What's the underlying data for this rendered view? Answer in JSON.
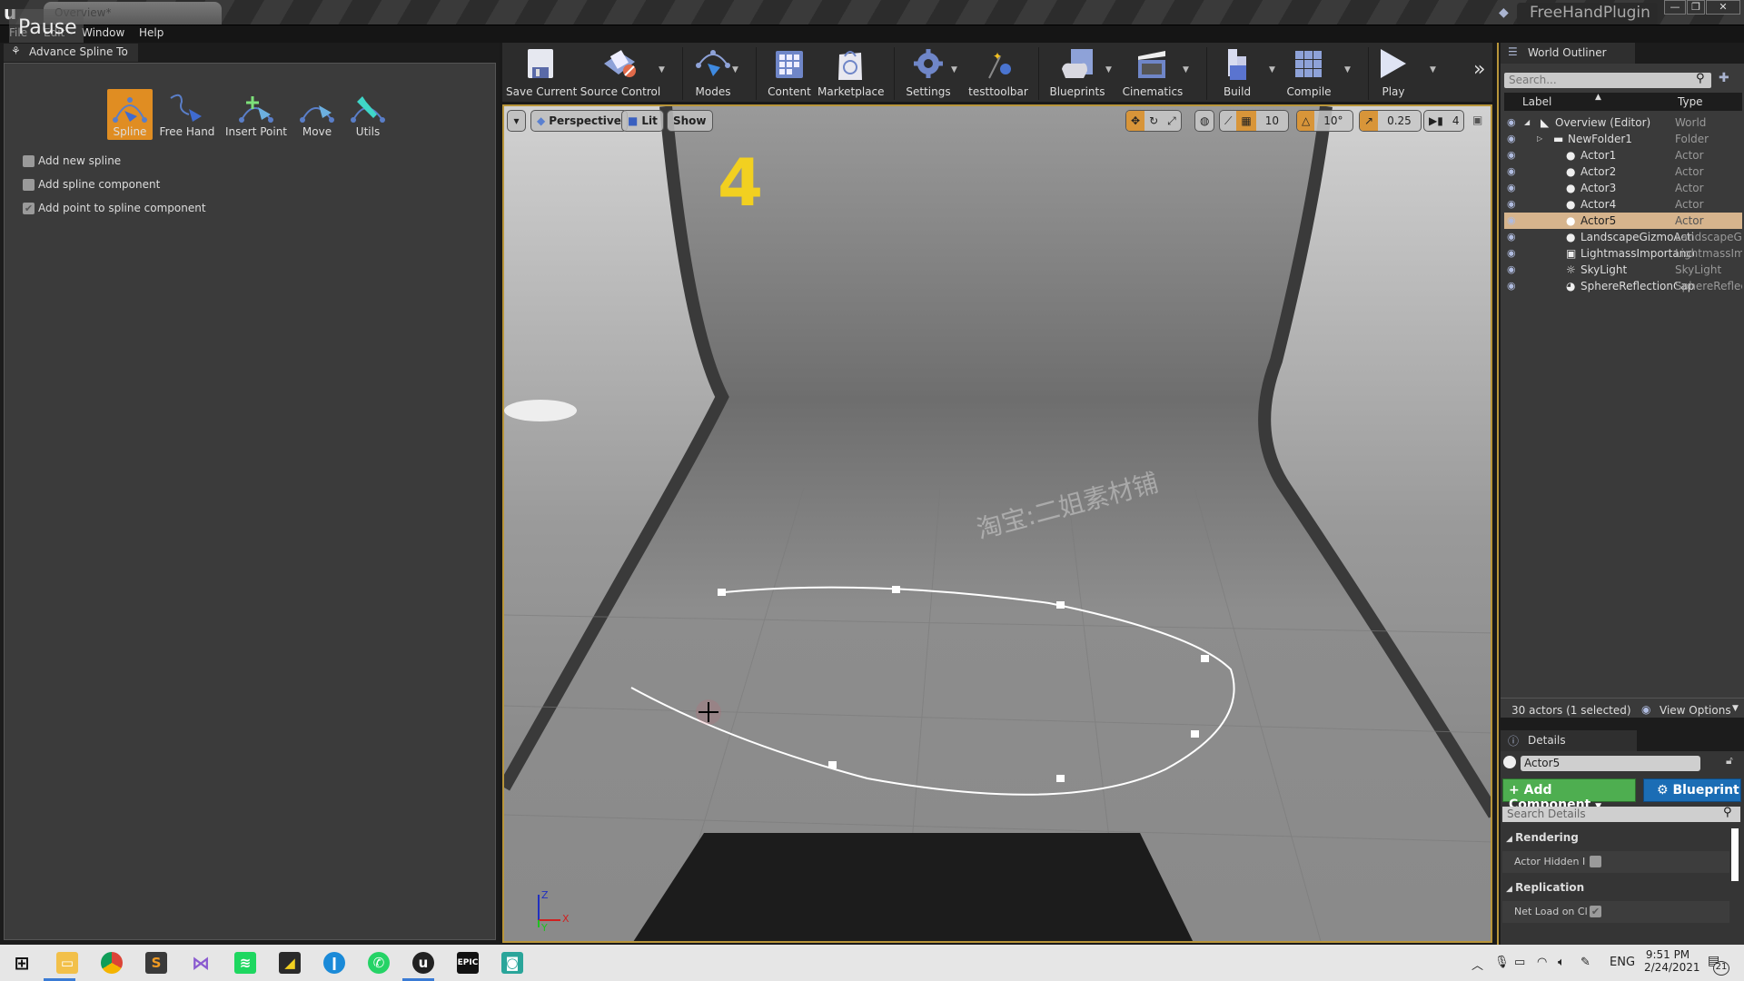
{
  "window": {
    "doc_tab": "Overview*",
    "project_name": "FreeHandPlugin",
    "pause_overlay": "Pause",
    "controls": {
      "minimize": "—",
      "restore": "❐",
      "close": "✕"
    }
  },
  "menu": {
    "items": [
      "File",
      "Edit",
      "Window",
      "Help"
    ]
  },
  "left_panel": {
    "tab_title": "Advance Spline To",
    "tools": [
      {
        "label": "Spline",
        "icon": "spline-icon",
        "active": true
      },
      {
        "label": "Free Hand",
        "icon": "free-hand-icon",
        "active": false
      },
      {
        "label": "Insert Point",
        "icon": "insert-point-icon",
        "active": false
      },
      {
        "label": "Move",
        "icon": "move-icon",
        "active": false
      },
      {
        "label": "Utils",
        "icon": "wrench-icon",
        "active": false
      }
    ],
    "options": [
      {
        "label": "Add new spline",
        "checked": false
      },
      {
        "label": "Add spline component",
        "checked": false
      },
      {
        "label": "Add point to spline component",
        "checked": true
      }
    ]
  },
  "toolbar": {
    "buttons": [
      {
        "label": "Save Current",
        "icon": "save-icon",
        "dropdown": false
      },
      {
        "label": "Source Control",
        "icon": "source-control-icon",
        "dropdown": true
      },
      {
        "label": "Modes",
        "icon": "modes-icon",
        "dropdown": true
      },
      {
        "label": "Content",
        "icon": "content-icon",
        "dropdown": false
      },
      {
        "label": "Marketplace",
        "icon": "marketplace-icon",
        "dropdown": false
      },
      {
        "label": "Settings",
        "icon": "settings-icon",
        "dropdown": true
      },
      {
        "label": "testtoolbar",
        "icon": "plugin-icon",
        "dropdown": false
      },
      {
        "label": "Blueprints",
        "icon": "blueprints-icon",
        "dropdown": true
      },
      {
        "label": "Cinematics",
        "icon": "cinematics-icon",
        "dropdown": true
      },
      {
        "label": "Build",
        "icon": "build-icon",
        "dropdown": true
      },
      {
        "label": "Compile",
        "icon": "compile-icon",
        "dropdown": true
      },
      {
        "label": "Play",
        "icon": "play-icon",
        "dropdown": true
      }
    ],
    "overflow": "»"
  },
  "viewport": {
    "view_mode": "Perspective",
    "lighting": "Lit",
    "show": "Show",
    "grid_snap": "10",
    "rotation_snap": "10°",
    "scale_snap": "0.25",
    "camera_speed": "4",
    "scene_label": "4",
    "axis": {
      "x": "X",
      "y": "Y",
      "z": "Z"
    },
    "watermark": "淘宝:二姐素材铺",
    "colors": {
      "spline": "#ffffff",
      "frame": "#b8953a",
      "label": "#f2d020"
    }
  },
  "outliner": {
    "title": "World Outliner",
    "search_placeholder": "Search...",
    "columns": {
      "label": "Label",
      "type": "Type"
    },
    "rows": [
      {
        "label": "Overview (Editor)",
        "type": "World",
        "indent": 0,
        "selected": false
      },
      {
        "label": "NewFolder1",
        "type": "Folder",
        "indent": 1,
        "selected": false
      },
      {
        "label": "Actor1",
        "type": "Actor",
        "indent": 2,
        "selected": false
      },
      {
        "label": "Actor2",
        "type": "Actor",
        "indent": 2,
        "selected": false
      },
      {
        "label": "Actor3",
        "type": "Actor",
        "indent": 2,
        "selected": false
      },
      {
        "label": "Actor4",
        "type": "Actor",
        "indent": 2,
        "selected": false
      },
      {
        "label": "Actor5",
        "type": "Actor",
        "indent": 2,
        "selected": true
      },
      {
        "label": "LandscapeGizmoActiv",
        "type": "LandscapeG",
        "indent": 2,
        "selected": false
      },
      {
        "label": "LightmassImportance",
        "type": "LightmassIm",
        "indent": 2,
        "selected": false
      },
      {
        "label": "SkyLight",
        "type": "SkyLight",
        "indent": 2,
        "selected": false
      },
      {
        "label": "SphereReflectionCapt",
        "type": "SphereReflec",
        "indent": 2,
        "selected": false
      }
    ],
    "status": "30 actors (1 selected)",
    "view_options": "View Options"
  },
  "details": {
    "title": "Details",
    "actor_name": "Actor5",
    "add_component": "+ Add Component",
    "blueprint": "Blueprint",
    "search_placeholder": "Search Details",
    "categories": [
      {
        "name": "Rendering",
        "property": "Actor Hidden I",
        "checked": false
      },
      {
        "name": "Replication",
        "property": "Net Load on Cl",
        "checked": true
      }
    ]
  },
  "taskbar": {
    "apps": [
      "Start",
      "File Explorer",
      "Chrome",
      "Sublime Text",
      "Visual Studio",
      "Spotify",
      "Sticky Notes",
      "App",
      "WhatsApp",
      "Unreal Engine",
      "Epic Games",
      "App"
    ],
    "language": "ENG",
    "time": "9:51 PM",
    "date": "2/24/2021",
    "notifications": "21"
  }
}
